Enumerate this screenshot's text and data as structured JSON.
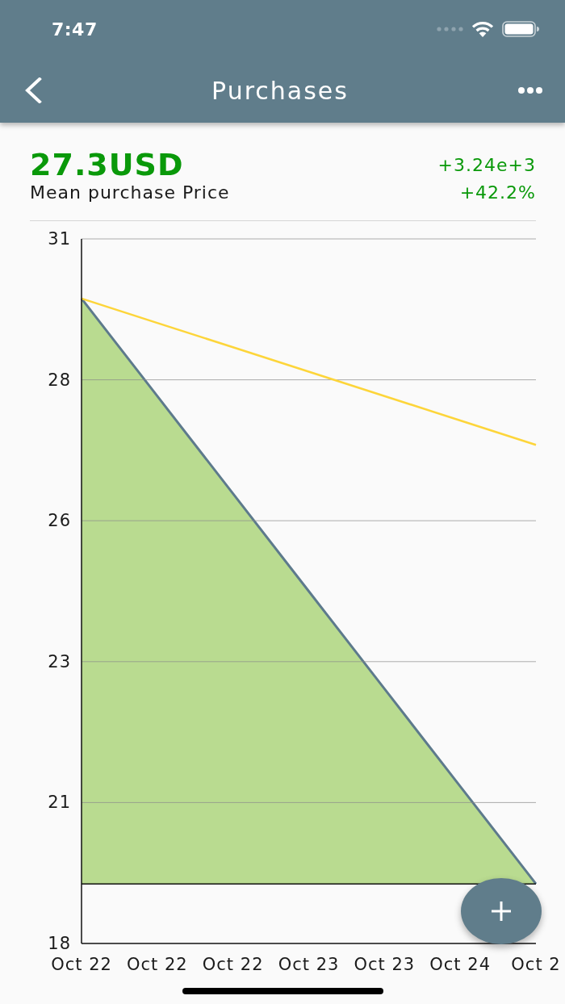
{
  "status_bar": {
    "time": "7:47"
  },
  "app_bar": {
    "title": "Purchases"
  },
  "summary": {
    "value": "27.3USD",
    "label": "Mean purchase Price",
    "change": "+3.24e+3",
    "change_percent": "+42.2%"
  },
  "chart": {
    "chart_data": {
      "type": "area",
      "categories": [
        "Oct 22",
        "Oct 22",
        "Oct 22",
        "Oct 23",
        "Oct 23",
        "Oct 24",
        "Oct 2"
      ],
      "ylim": [
        18,
        31
      ],
      "yticks": [
        18,
        {
          "value": 20.6,
          "label": "21"
        },
        {
          "value": 23.2,
          "label": "23"
        },
        {
          "value": 25.8,
          "label": "26"
        },
        {
          "value": 28.4,
          "label": "28"
        },
        31
      ],
      "grid": "y",
      "series": [
        {
          "type": "area",
          "color": "#b9db90",
          "values": [
            29.9,
            28.1,
            26.3,
            24.5,
            22.7,
            20.9,
            19.1
          ]
        },
        {
          "type": "line",
          "color": "#fdd53a",
          "values": [
            29.9,
            29.45,
            29.0,
            28.55,
            28.1,
            27.65,
            27.2
          ]
        }
      ],
      "ref_lines": [
        {
          "axis": "y",
          "value": 19.1,
          "color": "#111111"
        }
      ]
    }
  }
}
